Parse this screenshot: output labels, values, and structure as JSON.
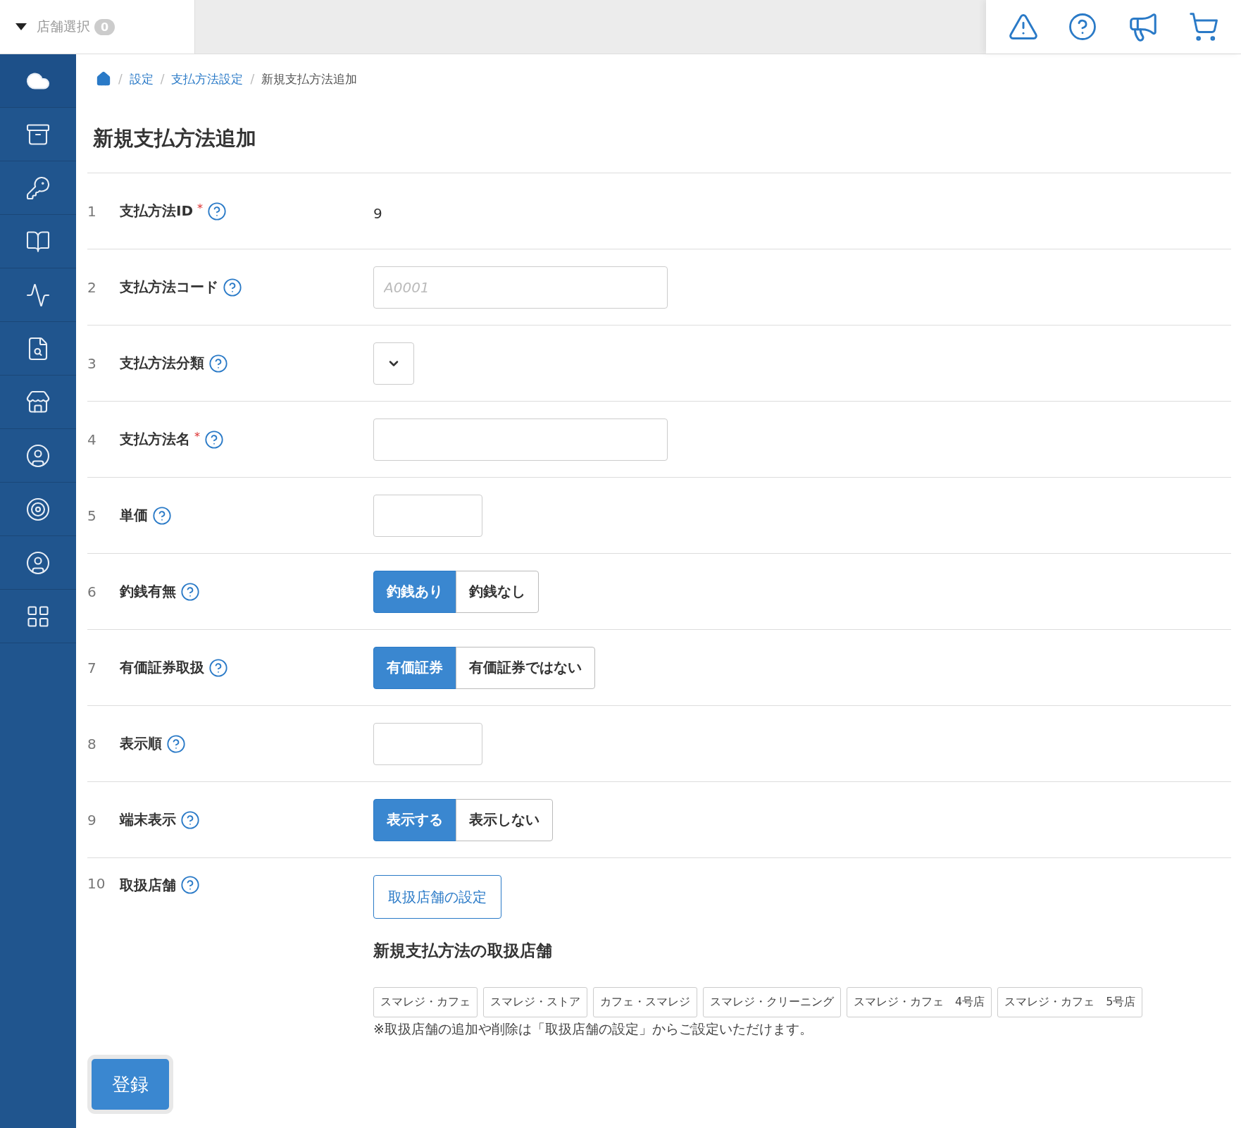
{
  "store_selector": {
    "label": "店舗選択",
    "count": "0"
  },
  "breadcrumb_separator": "/",
  "required_mark": "*",
  "breadcrumbs": [
    {
      "label": "設定",
      "link": true
    },
    {
      "label": "支払方法設定",
      "link": true
    },
    {
      "label": "新規支払方法追加",
      "link": false
    }
  ],
  "title": "新規支払方法追加",
  "rows": [
    {
      "no": "1",
      "label": "支払方法ID",
      "required": true,
      "kind": "text",
      "value": "9"
    },
    {
      "no": "2",
      "label": "支払方法コード",
      "required": false,
      "kind": "wide_input",
      "placeholder": "A0001"
    },
    {
      "no": "3",
      "label": "支払方法分類",
      "required": false,
      "kind": "select"
    },
    {
      "no": "4",
      "label": "支払方法名",
      "required": true,
      "kind": "wide_input"
    },
    {
      "no": "5",
      "label": "単価",
      "required": false,
      "kind": "narrow_input"
    },
    {
      "no": "6",
      "label": "釣銭有無",
      "required": false,
      "kind": "toggle",
      "options": [
        {
          "label": "釣銭あり",
          "selected": true
        },
        {
          "label": "釣銭なし",
          "selected": false
        }
      ]
    },
    {
      "no": "7",
      "label": "有価証券取扱",
      "required": false,
      "kind": "toggle",
      "options": [
        {
          "label": "有価証券",
          "selected": true
        },
        {
          "label": "有価証券ではない",
          "selected": false
        }
      ]
    },
    {
      "no": "8",
      "label": "表示順",
      "required": false,
      "kind": "narrow_input"
    },
    {
      "no": "9",
      "label": "端末表示",
      "required": false,
      "kind": "toggle",
      "options": [
        {
          "label": "表示する",
          "selected": true
        },
        {
          "label": "表示しない",
          "selected": false
        }
      ]
    },
    {
      "no": "10",
      "label": "取扱店舗",
      "required": false,
      "kind": "stores",
      "button": "取扱店舗の設定",
      "heading": "新規支払方法の取扱店舗",
      "tags": [
        "スマレジ・カフェ",
        "スマレジ・ストア",
        "カフェ・スマレジ",
        "スマレジ・クリーニング",
        "スマレジ・カフェ　4号店",
        "スマレジ・カフェ　5号店"
      ],
      "note": "※取扱店舗の追加や削除は「取扱店舗の設定」からご設定いただけます。"
    }
  ],
  "submit": "登録"
}
